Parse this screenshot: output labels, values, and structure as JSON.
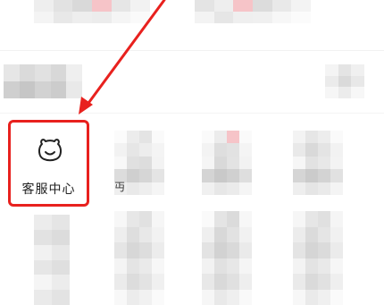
{
  "service_center": {
    "label": "客服中心",
    "icon": "bear-face-icon"
  },
  "clipped_text": "丏",
  "colors": {
    "highlight": "#e8211e",
    "text": "#222222",
    "mosaic_light": "#f0f0f0",
    "mosaic_mid": "#d6d6d6",
    "mosaic_pink": "#f6c4c8"
  }
}
